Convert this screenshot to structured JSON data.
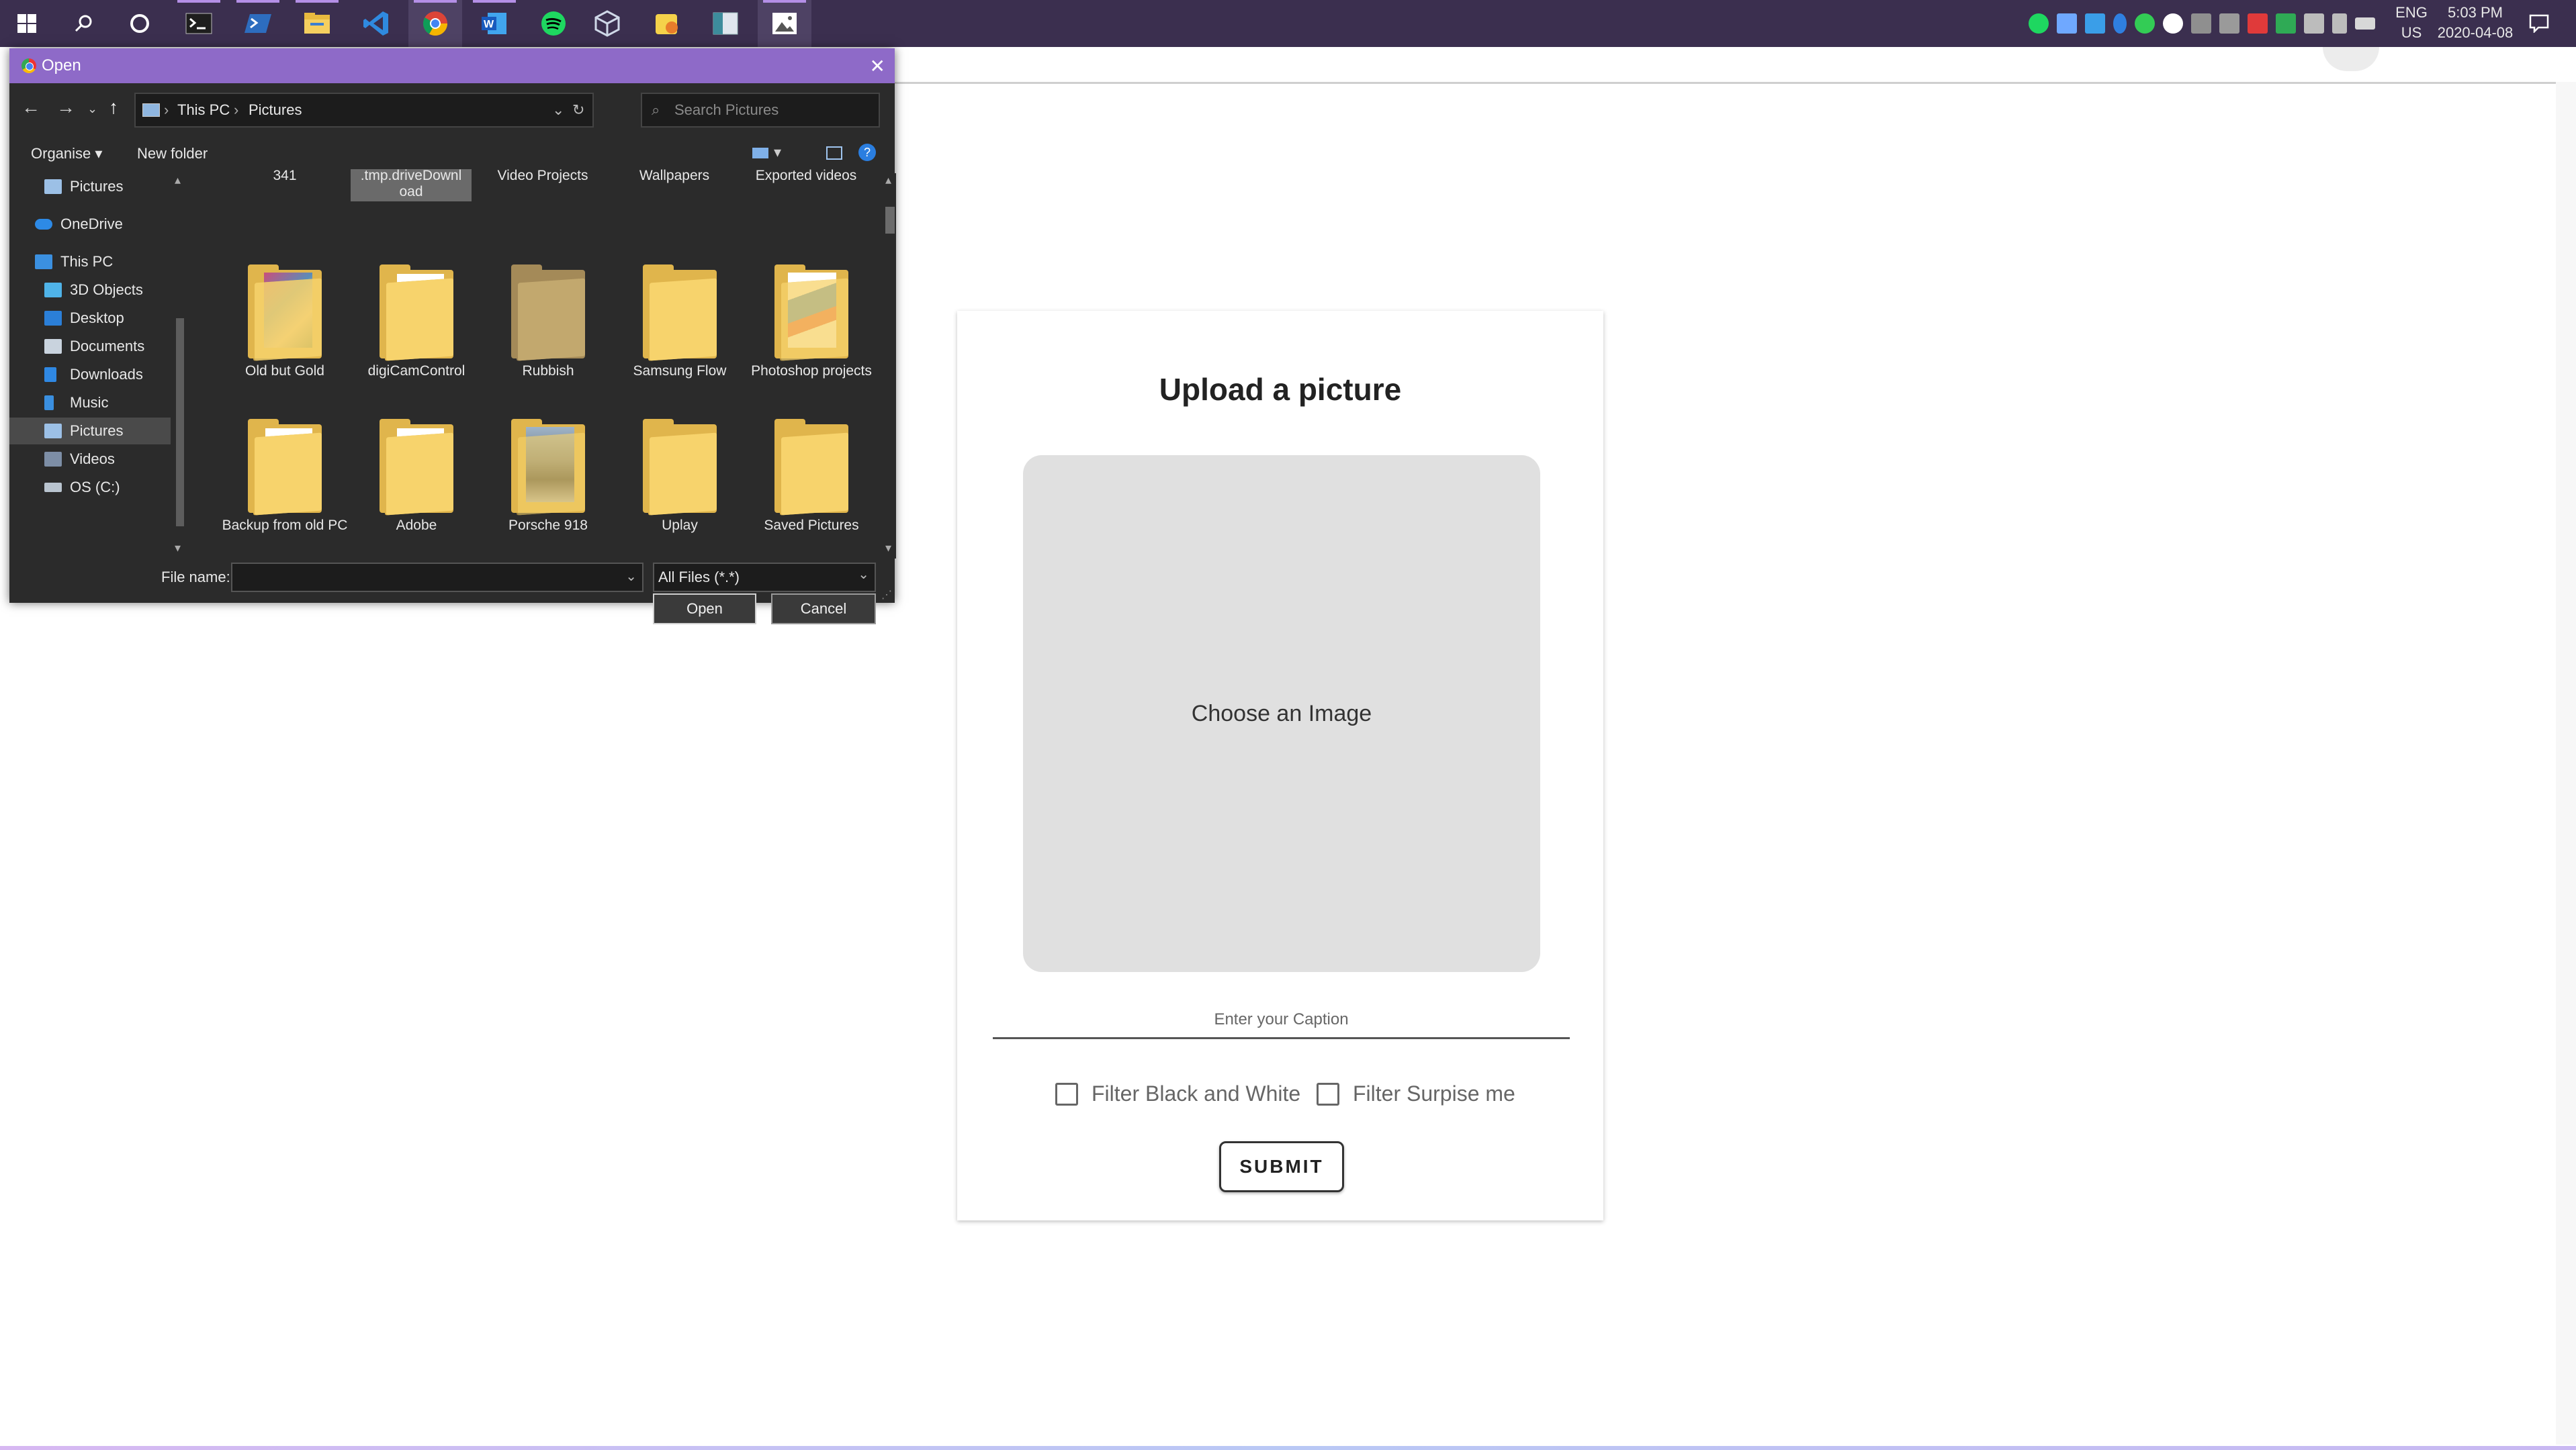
{
  "taskbar": {
    "apps": [
      {
        "name": "start-button"
      },
      {
        "name": "search"
      },
      {
        "name": "cortana"
      },
      {
        "name": "terminal"
      },
      {
        "name": "powershell"
      },
      {
        "name": "file-explorer"
      },
      {
        "name": "vscode"
      },
      {
        "name": "chrome"
      },
      {
        "name": "word"
      },
      {
        "name": "spotify"
      },
      {
        "name": "virtualbox"
      },
      {
        "name": "sticky-app"
      },
      {
        "name": "screen-app"
      },
      {
        "name": "photos"
      }
    ],
    "lang": "ENG",
    "region": "US",
    "time": "5:03 PM",
    "date": "2020-04-08"
  },
  "dialog": {
    "title": "Open",
    "breadcrumb": [
      "This PC",
      "Pictures"
    ],
    "search_placeholder": "Search Pictures",
    "organise_label": "Organise",
    "new_folder_label": "New folder",
    "nav_items": [
      {
        "label": "Pictures",
        "icon": "pictures-icon"
      },
      {
        "label": "OneDrive",
        "icon": "onedrive-icon"
      },
      {
        "label": "This PC",
        "icon": "pc-icon"
      },
      {
        "label": "3D Objects",
        "icon": "3d-objects-icon"
      },
      {
        "label": "Desktop",
        "icon": "desktop-icon"
      },
      {
        "label": "Documents",
        "icon": "documents-icon"
      },
      {
        "label": "Downloads",
        "icon": "downloads-icon"
      },
      {
        "label": "Music",
        "icon": "music-icon"
      },
      {
        "label": "Pictures",
        "icon": "pictures-icon"
      },
      {
        "label": "Videos",
        "icon": "videos-icon"
      },
      {
        "label": "OS (C:)",
        "icon": "drive-icon"
      }
    ],
    "top_row_labels": [
      "341",
      ".tmp.driveDownl\noad",
      "Video Projects",
      "Wallpapers",
      "Exported videos"
    ],
    "folders_row1": [
      "Old but Gold",
      "digiCamControl",
      "Rubbish",
      "Samsung Flow",
      "Photoshop projects"
    ],
    "folders_row2": [
      "Backup from old PC",
      "Adobe",
      "Porsche 918",
      "Uplay",
      "Saved Pictures"
    ],
    "file_name_label": "File name:",
    "file_name_value": "",
    "file_type": "All Files (*.*)",
    "open_label": "Open",
    "cancel_label": "Cancel"
  },
  "upload": {
    "title": "Upload a picture",
    "dropzone_label": "Choose an Image",
    "caption_placeholder": "Enter your Caption",
    "filter_bw": "Filter Black and White",
    "filter_surprise": "Filter Surpise me",
    "submit_label": "SUBMIT"
  },
  "colors": {
    "taskbar": "#3b2f4f",
    "dialog_title": "#8e6ac8",
    "dialog_bg": "#2b2b2b",
    "dropzone": "#e0e0e0",
    "folder": "#f7d36c"
  }
}
